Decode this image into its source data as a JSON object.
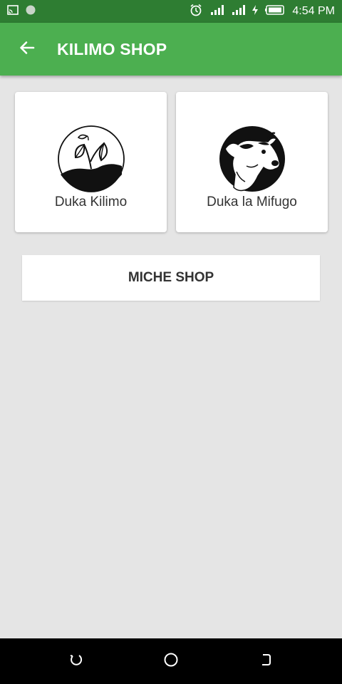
{
  "status_bar": {
    "time": "4:54 PM",
    "icons": [
      "screen-cast-icon",
      "notification-dot-icon",
      "alarm-icon",
      "signal-icon",
      "signal-icon",
      "charging-icon",
      "battery-icon"
    ]
  },
  "app_bar": {
    "title": "KILIMO SHOP",
    "back_icon": "arrow-left-icon",
    "color": "#4caf50"
  },
  "cards": [
    {
      "label": "Duka Kilimo",
      "icon": "plant-sprout-icon"
    },
    {
      "label": "Duka la Mifugo",
      "icon": "cow-head-icon"
    }
  ],
  "miche_button": {
    "label": "MICHE SHOP"
  },
  "nav_bar": {
    "icons": [
      "recent-apps-icon",
      "home-icon",
      "back-icon"
    ]
  }
}
